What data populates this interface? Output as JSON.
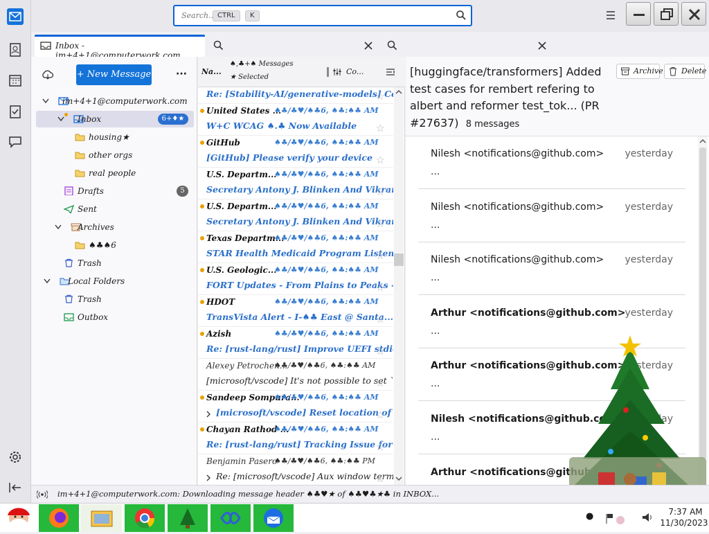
{
  "window": {
    "search_placeholder": "Search...",
    "search_key1": "CTRL",
    "search_key2": "K"
  },
  "colors": {
    "accent": "#0b63d6",
    "new_message": "#1373d9",
    "unread_dot": "#e9a000",
    "taskbar_green": "#25b83a"
  },
  "tab": {
    "title": "Inbox - im+4+1@computerwork.com"
  },
  "folders": {
    "new_message": "+ New Message",
    "items": [
      {
        "label": "im+4+1@computerwork.com",
        "icon": "account-icon"
      },
      {
        "label": "Inbox",
        "icon": "inbox-icon",
        "badge": "6+♦★"
      },
      {
        "label": "housing★",
        "icon": "folder-icon"
      },
      {
        "label": "other orgs",
        "icon": "folder-icon"
      },
      {
        "label": "real people",
        "icon": "folder-icon"
      },
      {
        "label": "Drafts",
        "icon": "drafts-icon",
        "badge": "5"
      },
      {
        "label": "Sent",
        "icon": "sent-icon"
      },
      {
        "label": "Archives",
        "icon": "archive-icon"
      },
      {
        "label": "♠♣♠6",
        "icon": "folder-icon"
      },
      {
        "label": "Trash",
        "icon": "trash-icon"
      },
      {
        "label": "Local Folders",
        "icon": "local-folders-icon"
      },
      {
        "label": "Trash",
        "icon": "trash-icon"
      },
      {
        "label": "Outbox",
        "icon": "outbox-icon"
      }
    ]
  },
  "list": {
    "count_line1": "♠,♣+♠ Messages",
    "count_line2": "★ Selected",
    "col_name": "Na...",
    "col_from": "Co...",
    "messages": [
      {
        "sender": "",
        "date": "",
        "subject": "Re: [Stability-AI/generative-models] Co...",
        "unread": true,
        "dot": false
      },
      {
        "sender": "United States ...",
        "date": "♠♣/♣♥/♠♣6, ♠♣:♠♣ AM",
        "subject": "W+C WCAG ♠.♣ Now Available",
        "unread": true,
        "dot": true
      },
      {
        "sender": "GitHub",
        "date": "♠♣/♣♥/♠♣6, ♠♣:♠♣ AM",
        "subject": "[GitHub] Please verify your device",
        "unread": true,
        "dot": true
      },
      {
        "sender": "U.S. Departm...",
        "date": "♠♣/♣♥/♠♣6, ♠♣:♠♣ AM",
        "subject": "Secretary Antony J. Blinken And Vikram...",
        "unread": true,
        "dot": false
      },
      {
        "sender": "U.S. Departm...",
        "date": "♠♣/♣♥/♠♣6, ♠♣:♠♣ AM",
        "subject": "Secretary Antony J. Blinken And Vikram...",
        "unread": true,
        "dot": true
      },
      {
        "sender": "Texas Departm...",
        "date": "♠♣/♣♥/♠♣6, ♠♣:♠♣ AM",
        "subject": "STAR Health Medicaid Program Listen...",
        "unread": true,
        "dot": true
      },
      {
        "sender": "U.S. Geologic...",
        "date": "♠♣/♣♥/♠♣6, ♠♣:♠♣ AM",
        "subject": "FORT Updates - From Plains to Peaks -...",
        "unread": true,
        "dot": true
      },
      {
        "sender": "HDOT",
        "date": "♠♣/♣♥/♠♣6, ♠♣:♠♣ AM",
        "subject": "TransVista Alert - I-♠♣ East @ Santa...",
        "unread": true,
        "dot": true
      },
      {
        "sender": "Azish",
        "date": "♠♣/♣♥/♠♣6, ♠♣:♠♣ AM",
        "subject": "Re: [rust-lang/rust] Improve UEFI stdio...",
        "unread": true,
        "dot": true
      },
      {
        "sender": "Alexey Petrochen...",
        "date": "♠♣/♣♥/♠♣6, ♠♣:♠♣ AM",
        "subject": "[microsoft/vscode] It's not possible to set `editor...",
        "unread": false,
        "dot": false
      },
      {
        "sender": "Sandeep Sompura...",
        "date": "♠♣/♣♥/♠♣6, ♠♣:♠♣ AM",
        "subject": "[microsoft/vscode] Reset location of view...",
        "unread": true,
        "dot": true
      },
      {
        "sender": "Chayan Rathod ...",
        "date": "♠♣/♣♥/♠♣6, ♠♣:♠♣ AM",
        "subject": "Re: [rust-lang/rust] Tracking Issue for `ge...",
        "unread": true,
        "dot": true
      },
      {
        "sender": "Benjamin Pasero",
        "date": "♠♣/♣♥/♠♣6, ♠♣:♠♣ PM",
        "subject": "Re: [microsoft/vscode] Aux window termina...",
        "unread": false,
        "dot": false
      }
    ]
  },
  "reader": {
    "title": "[huggingface/transformers] Added test cases for rembert refering to albert and reformer test_tok... (PR #27637)",
    "count": "8 messages",
    "archive": "Archive",
    "delete": "Delete",
    "threads": [
      {
        "from": "Nilesh <notifications@github.com>",
        "when": "yesterday",
        "preview": "...",
        "bold": false
      },
      {
        "from": "Nilesh <notifications@github.com>",
        "when": "yesterday",
        "preview": "...",
        "bold": false
      },
      {
        "from": "Nilesh <notifications@github.com>",
        "when": "yesterday",
        "preview": "...",
        "bold": false
      },
      {
        "from": "Arthur <notifications@github.com>",
        "when": "yesterday",
        "preview": "...",
        "bold": true
      },
      {
        "from": "Arthur <notifications@github.com>",
        "when": "yesterday",
        "preview": "...",
        "bold": true
      },
      {
        "from": "Nilesh <notifications@github.com>",
        "when": "yesterday",
        "preview": "...",
        "bold": true
      },
      {
        "from": "Arthur <notifications@github.com>",
        "when": "yesterday",
        "preview": "",
        "bold": true
      }
    ]
  },
  "status": {
    "text": "im+4+1@computerwork.com: Downloading message header ♠♣♥★ of ♠♣♥♣★♣ in INBOX..."
  },
  "tray": {
    "time": "7:37 AM",
    "date": "11/30/2023"
  }
}
